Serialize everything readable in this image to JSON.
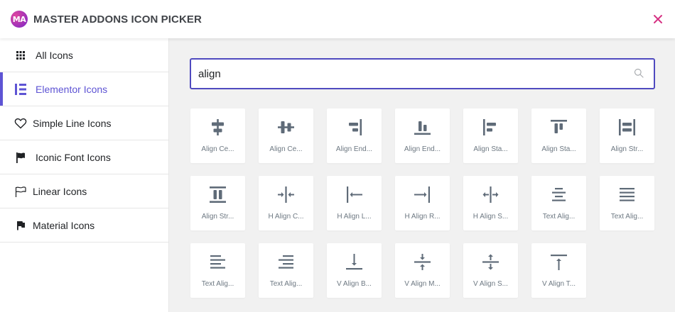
{
  "header": {
    "logo_text": "MA",
    "title": "MASTER ADDONS ICON PICKER",
    "close_icon": "close-icon",
    "accent_color": "#d63384"
  },
  "sidebar": {
    "active_color": "#5e54d4",
    "items": [
      {
        "label": "All Icons",
        "icon": "grid-icon"
      },
      {
        "label": "Elementor Icons",
        "icon": "elementor-icon"
      },
      {
        "label": "Simple Line Icons",
        "icon": "heart-icon"
      },
      {
        "label": "Iconic Font Icons",
        "icon": "flag-icon"
      },
      {
        "label": "Linear Icons",
        "icon": "linear-flag-icon"
      },
      {
        "label": "Material Icons",
        "icon": "material-flag-icon"
      }
    ]
  },
  "search": {
    "value": "align",
    "icon": "search-icon"
  },
  "results": [
    {
      "label": "Align Ce...",
      "icon": "align-center-h-icon"
    },
    {
      "label": "Align Ce...",
      "icon": "align-center-v-icon"
    },
    {
      "label": "Align End...",
      "icon": "align-end-h-icon"
    },
    {
      "label": "Align End...",
      "icon": "align-end-v-icon"
    },
    {
      "label": "Align Sta...",
      "icon": "align-start-h-icon"
    },
    {
      "label": "Align Sta...",
      "icon": "align-start-v-icon"
    },
    {
      "label": "Align Str...",
      "icon": "align-stretch-h-icon"
    },
    {
      "label": "Align Str...",
      "icon": "align-stretch-v-icon"
    },
    {
      "label": "H Align C...",
      "icon": "h-align-center-icon"
    },
    {
      "label": "H Align L...",
      "icon": "h-align-left-icon"
    },
    {
      "label": "H Align R...",
      "icon": "h-align-right-icon"
    },
    {
      "label": "H Align S...",
      "icon": "h-align-stretch-icon"
    },
    {
      "label": "Text Alig...",
      "icon": "text-align-center-icon"
    },
    {
      "label": "Text Alig...",
      "icon": "text-align-justify-icon"
    },
    {
      "label": "Text Alig...",
      "icon": "text-align-left-icon"
    },
    {
      "label": "Text Alig...",
      "icon": "text-align-right-icon"
    },
    {
      "label": "V Align B...",
      "icon": "v-align-bottom-icon"
    },
    {
      "label": "V Align M...",
      "icon": "v-align-middle-icon"
    },
    {
      "label": "V Align S...",
      "icon": "v-align-stretch-icon"
    },
    {
      "label": "V Align T...",
      "icon": "v-align-top-icon"
    }
  ]
}
